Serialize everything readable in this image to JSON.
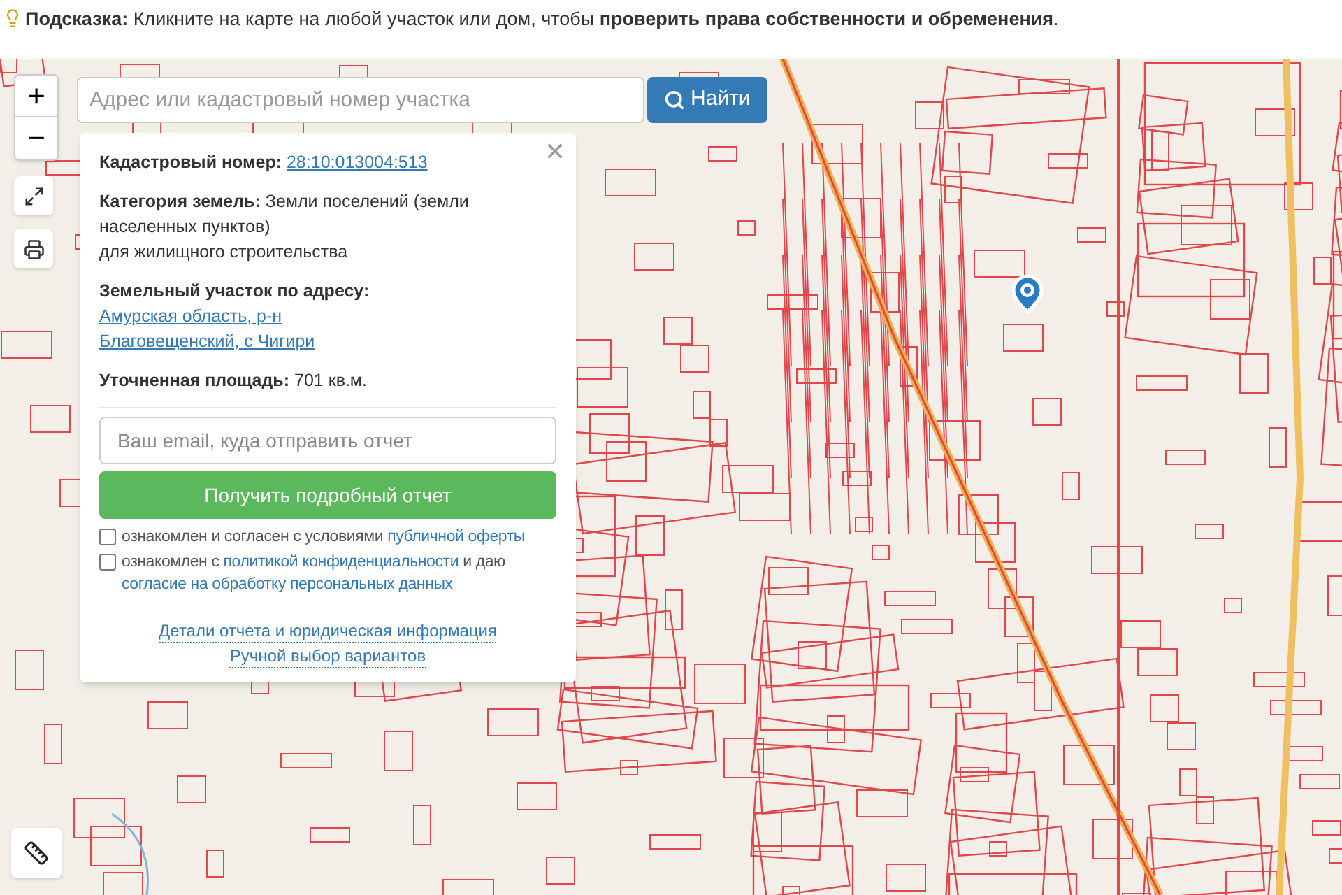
{
  "hint": {
    "text": "**Подсказка:** Кликните на карте на любой участок или дом, чтобы **проверить права собственности и обременения**."
  },
  "search": {
    "placeholder": "Адрес или кадастровый номер участка",
    "button": "Найти"
  },
  "zoom": {
    "in": "+",
    "out": "−"
  },
  "popup": {
    "close": "×",
    "fields": [
      {
        "label": "Кадастровый номер:",
        "kind": "link",
        "lines": [
          "28:10:013004:513"
        ]
      },
      {
        "label": "Категория земель:",
        "kind": "text",
        "lines": [
          "Земли поселений (земли населенных пунктов)",
          "для жилищного строительства"
        ]
      },
      {
        "label": "Земельный участок по адресу:",
        "kind": "link",
        "lines": [
          "Амурская область, р-н",
          "Благовещенский, с Чигири"
        ]
      },
      {
        "label": "Уточненная площадь:",
        "kind": "text",
        "lines": [
          "701 кв.м."
        ]
      }
    ],
    "email": {
      "placeholder": "Ваш email, куда отправить отчет"
    },
    "submit": "Получить подробный отчет",
    "consents": [
      {
        "checked": false,
        "parts": [
          {
            "kind": "text",
            "text": "ознакомлен и согласен с условиями"
          },
          {
            "kind": "link",
            "text": "публичной оферты"
          }
        ]
      },
      {
        "checked": false,
        "parts": [
          {
            "kind": "text",
            "text": "ознакомлен с"
          },
          {
            "kind": "link",
            "text": "политикой конфиденциальности"
          },
          {
            "kind": "text",
            "text": "и даю"
          },
          {
            "kind": "link",
            "text": "согласие на обработку персональных данных"
          }
        ]
      }
    ],
    "links": [
      "Детали отчета и юридическая информация",
      "Ручной выбор вариантов"
    ]
  }
}
